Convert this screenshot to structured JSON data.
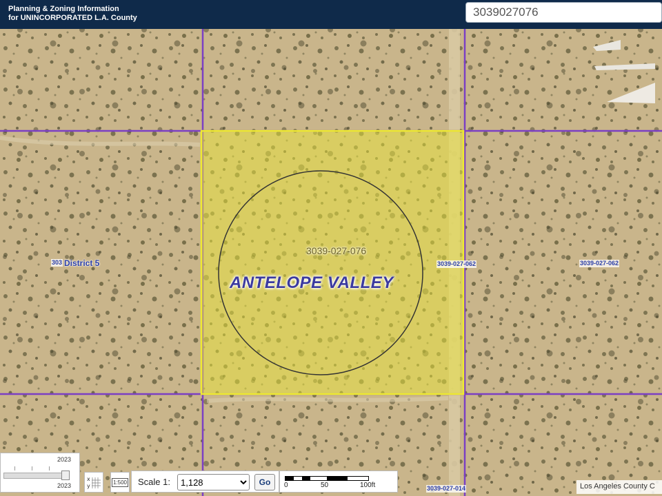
{
  "header": {
    "title_line1": "Planning & Zoning Information",
    "title_line2": "for UNINCORPORATED L.A. County",
    "search_value": "3039027076"
  },
  "map": {
    "selected_parcel_label": "3039-027-076",
    "district_label": "District 5",
    "district_prefix": "303",
    "area_label": "ANTELOPE VALLEY",
    "parcel_labels": {
      "east_edge": "3039-027-062",
      "east": "3039-027-062",
      "south": "3039-027-014"
    },
    "colors": {
      "parcel_line": "#7b3fc4",
      "selection": "#e8e63a",
      "ground": "#c8b48a"
    }
  },
  "year_slider": {
    "top_label": "2023",
    "bottom_label": "2023",
    "value_fraction": 1.0
  },
  "tools": {
    "xy_icon": "xy-coordinates-icon",
    "scale_icon": "scale-1500-icon",
    "scale_icon_text": "1:500"
  },
  "scale": {
    "label": "Scale 1:",
    "value": "1,128",
    "options": [
      "1,128"
    ],
    "go_label": "Go"
  },
  "scalebar": {
    "labels": [
      "0",
      "50",
      "100ft"
    ]
  },
  "attribution": "Los Angeles County C"
}
